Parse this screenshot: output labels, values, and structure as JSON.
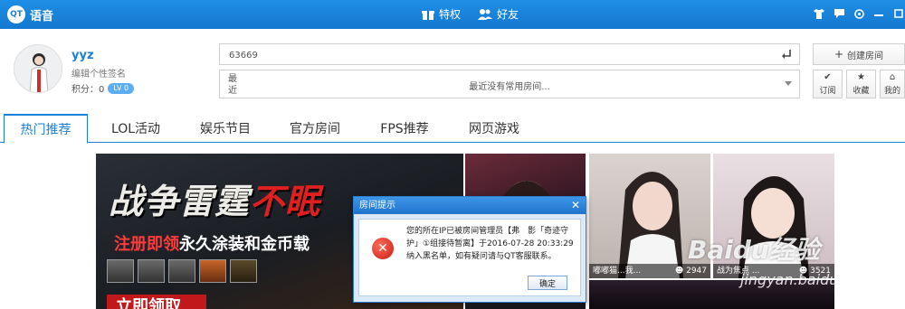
{
  "app": {
    "logo_badge": "QT",
    "name": "语音"
  },
  "titlebar": {
    "privilege_label": "特权",
    "friends_label": "好友"
  },
  "profile": {
    "username": "yyz",
    "signature": "编辑个性签名",
    "points_label": "积分：0",
    "level": "LV 0"
  },
  "room_search": {
    "value": "63669"
  },
  "recent": {
    "label": "最近",
    "empty_text": "最近没有常用房间..."
  },
  "actions": {
    "create_room": "创建房间",
    "subscribe": "订阅",
    "favorite": "收藏",
    "my_rooms": "我的"
  },
  "tabs": [
    {
      "label": "热门推荐",
      "active": true
    },
    {
      "label": "LOL活动",
      "active": false
    },
    {
      "label": "娱乐节目",
      "active": false
    },
    {
      "label": "官方房间",
      "active": false
    },
    {
      "label": "FPS推荐",
      "active": false
    },
    {
      "label": "网页游戏",
      "active": false
    }
  ],
  "banner": {
    "title_a": "战争雷霆",
    "title_b": "不眠",
    "subtitle_a": "注册即领",
    "subtitle_b": "永久涂装和金币载",
    "cta": "立即领取"
  },
  "tiles": [
    {
      "name": "嘟嘟猫...我...",
      "count": "2947"
    },
    {
      "name": "战为焦点 ...",
      "count": "3521"
    }
  ],
  "watermark": {
    "brand": "Baidu经验",
    "url": "jingyan.baidu.com"
  },
  "dialog": {
    "title": "房间提示",
    "close": "✕",
    "message": "您的所在IP已被房间管理员【弗　影「奇迹守护」①组接待暂离】于2016-07-28 20:33:29纳入黑名单，如有疑问请与QT客服联系。",
    "ok": "确定"
  },
  "colors": {
    "accent": "#1a80d9",
    "titlebar": "#1478cf",
    "error": "#c71d12"
  }
}
